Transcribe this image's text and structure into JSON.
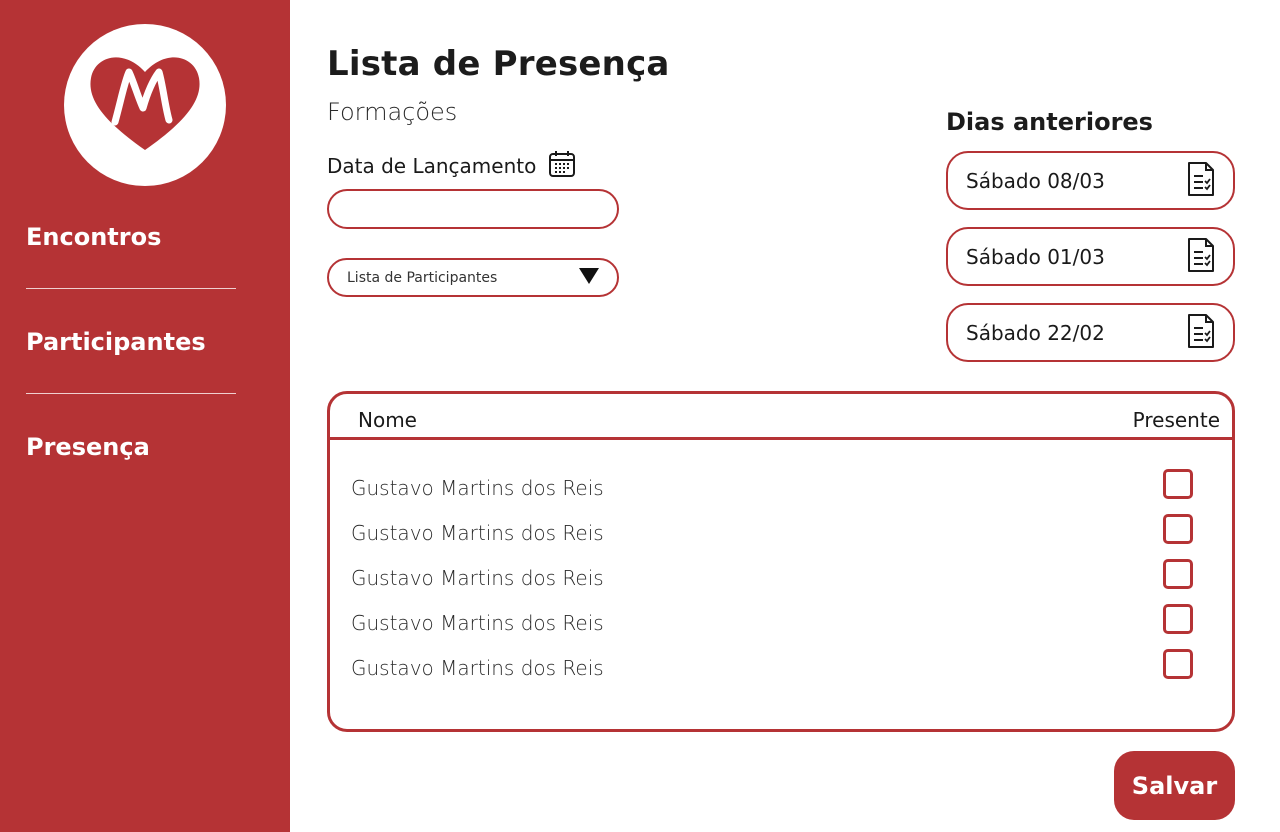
{
  "colors": {
    "accent": "#b53335",
    "background": "#ffffff",
    "text": "#1c1c1c"
  },
  "sidebar": {
    "logo_icon": "heart-m-logo",
    "items": [
      {
        "label": "Encontros"
      },
      {
        "label": "Participantes"
      },
      {
        "label": "Presença"
      }
    ]
  },
  "header": {
    "title": "Lista de Presença",
    "subtitle": "Formações"
  },
  "form": {
    "date_label": "Data de Lançamento",
    "date_icon": "calendar-icon",
    "date_value": "",
    "select_label": "Lista de Participantes",
    "select_icon": "triangle-down-icon"
  },
  "previous_days": {
    "title": "Dias anteriores",
    "items": [
      {
        "label": "Sábado 08/03",
        "icon": "checklist-document-icon"
      },
      {
        "label": "Sábado 01/03",
        "icon": "checklist-document-icon"
      },
      {
        "label": "Sábado 22/02",
        "icon": "checklist-document-icon"
      }
    ]
  },
  "table": {
    "columns": [
      "Nome",
      "Presente"
    ],
    "rows": [
      {
        "name": "Gustavo Martins dos Reis",
        "present": false
      },
      {
        "name": "Gustavo Martins dos Reis",
        "present": false
      },
      {
        "name": "Gustavo Martins dos Reis",
        "present": false
      },
      {
        "name": "Gustavo Martins dos Reis",
        "present": false
      },
      {
        "name": "Gustavo Martins dos Reis",
        "present": false
      }
    ]
  },
  "actions": {
    "save_label": "Salvar"
  }
}
